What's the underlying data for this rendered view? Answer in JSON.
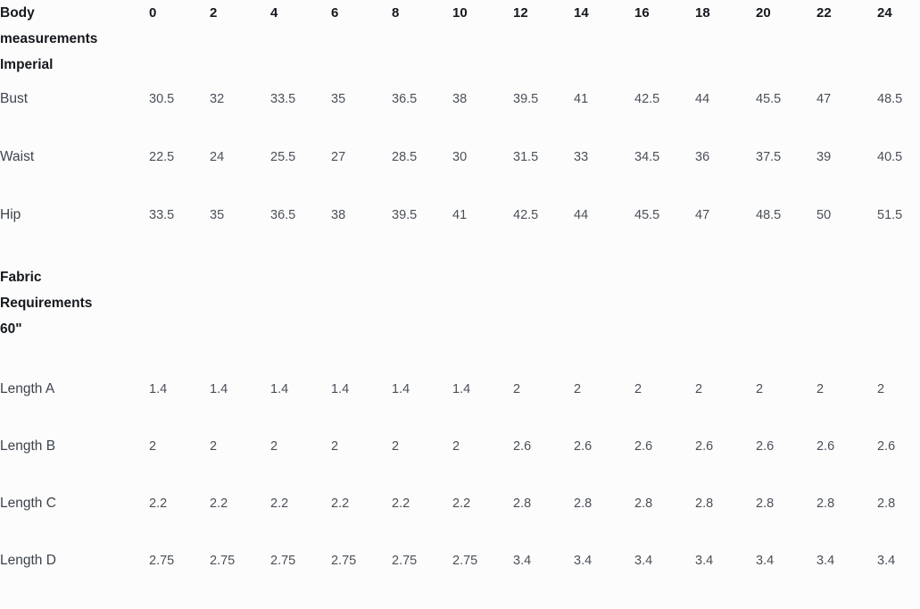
{
  "table": {
    "sections": [
      {
        "id": "body-measurements",
        "title": "Body measurements Imperial",
        "title_lines": [
          "Body",
          "measurements",
          "Imperial"
        ],
        "sizes": [
          "0",
          "2",
          "4",
          "6",
          "8",
          "10",
          "12",
          "14",
          "16",
          "18",
          "20",
          "22",
          "24"
        ],
        "rows": [
          {
            "label": "Bust",
            "values": [
              "30.5",
              "32",
              "33.5",
              "35",
              "36.5",
              "38",
              "39.5",
              "41",
              "42.5",
              "44",
              "45.5",
              "47",
              "48.5"
            ]
          },
          {
            "label": "Waist",
            "values": [
              "22.5",
              "24",
              "25.5",
              "27",
              "28.5",
              "30",
              "31.5",
              "33",
              "34.5",
              "36",
              "37.5",
              "39",
              "40.5"
            ]
          },
          {
            "label": "Hip",
            "values": [
              "33.5",
              "35",
              "36.5",
              "38",
              "39.5",
              "41",
              "42.5",
              "44",
              "45.5",
              "47",
              "48.5",
              "50",
              "51.5"
            ]
          }
        ]
      },
      {
        "id": "fabric-requirements",
        "title": "Fabric Requirements 60\"",
        "title_lines": [
          "Fabric",
          "Requirements",
          "60\""
        ],
        "rows": [
          {
            "label": "Length A",
            "values": [
              "1.4",
              "1.4",
              "1.4",
              "1.4",
              "1.4",
              "1.4",
              "2",
              "2",
              "2",
              "2",
              "2",
              "2",
              "2"
            ]
          },
          {
            "label": "Length B",
            "values": [
              "2",
              "2",
              "2",
              "2",
              "2",
              "2",
              "2.6",
              "2.6",
              "2.6",
              "2.6",
              "2.6",
              "2.6",
              "2.6"
            ]
          },
          {
            "label": "Length C",
            "values": [
              "2.2",
              "2.2",
              "2.2",
              "2.2",
              "2.2",
              "2.2",
              "2.8",
              "2.8",
              "2.8",
              "2.8",
              "2.8",
              "2.8",
              "2.8"
            ]
          },
          {
            "label": "Length D",
            "values": [
              "2.75",
              "2.75",
              "2.75",
              "2.75",
              "2.75",
              "2.75",
              "3.4",
              "3.4",
              "3.4",
              "3.4",
              "3.4",
              "3.4",
              "3.4"
            ]
          }
        ]
      }
    ]
  },
  "colors": {
    "background": "#fcfcfc",
    "heading_text": "#15181d",
    "label_text": "#3d434d",
    "value_text": "#4a5059"
  }
}
